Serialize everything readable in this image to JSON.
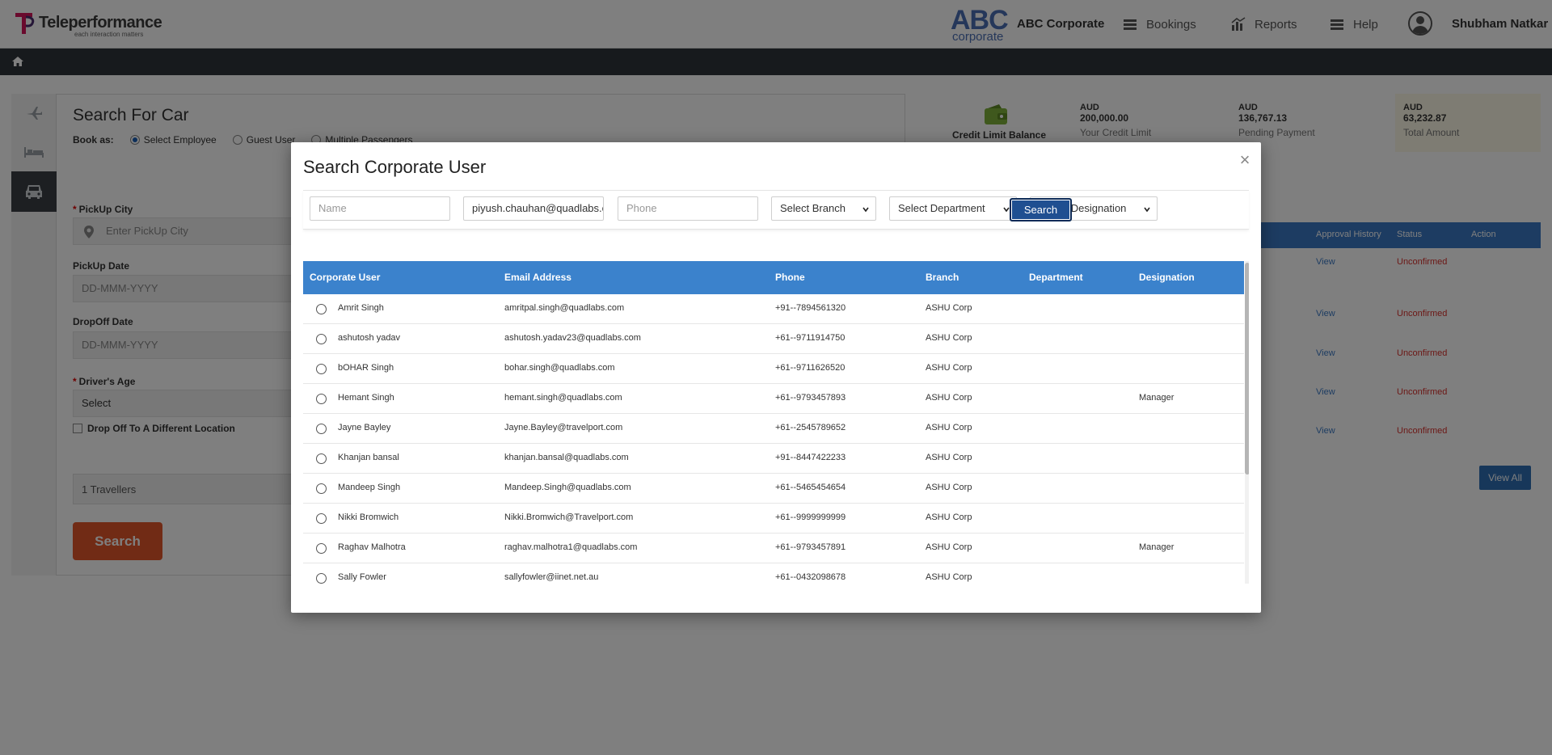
{
  "header": {
    "brand_name": "Teleperformance",
    "brand_tagline": "each interaction matters",
    "client_logo_big": "ABC",
    "client_logo_small": "corporate",
    "corporate_name": "ABC Corporate",
    "nav": [
      {
        "label": "Bookings",
        "icon": "list-icon"
      },
      {
        "label": "Reports",
        "icon": "bar-chart-icon"
      },
      {
        "label": "Help",
        "icon": "list-icon"
      }
    ],
    "user_name": "Shubham Natkar"
  },
  "background": {
    "form_title": "Search For Car",
    "book_as_label": "Book as:",
    "book_as_options": [
      "Select Employee",
      "Guest User",
      "Multiple Passengers"
    ],
    "pickup_city_label": "PickUp City",
    "pickup_city_placeholder": "Enter PickUp City",
    "pickup_date_label": "PickUp Date",
    "pickup_date_placeholder": "DD-MMM-YYYY",
    "dropoff_date_label": "DropOff Date",
    "dropoff_date_placeholder": "DD-MMM-YYYY",
    "drivers_age_label": "Driver's Age",
    "drivers_age_value": "Select",
    "different_location_label": "Drop Off To A Different Location",
    "travellers": "1 Travellers",
    "search_label": "Search",
    "credit_limit_label": "Credit Limit Balance",
    "credits": [
      {
        "currency": "AUD",
        "amount": "200,000.00",
        "desc": "Your Credit Limit"
      },
      {
        "currency": "AUD",
        "amount": "136,767.13",
        "desc": "Pending Payment"
      },
      {
        "currency": "AUD",
        "amount": "63,232.87",
        "desc": "Total Amount"
      }
    ],
    "table_headers": [
      "Approval History",
      "Status",
      "Action"
    ],
    "rows": [
      {
        "link": "View",
        "status": "Unconfirmed"
      },
      {
        "link": "View",
        "status": "Unconfirmed"
      },
      {
        "link": "View",
        "status": "Unconfirmed"
      },
      {
        "link": "View",
        "status": "Unconfirmed"
      },
      {
        "link": "View",
        "status": "Unconfirmed"
      }
    ],
    "view_all_label": "View All"
  },
  "modal": {
    "title": "Search Corporate User",
    "close_symbol": "×",
    "filters": {
      "name_placeholder": "Name",
      "email_value": "piyush.chauhan@quadlabs.c",
      "phone_placeholder": "Phone",
      "branch": "Select Branch",
      "department": "Select Department",
      "designation": "Select Designation",
      "search_label": "Search"
    },
    "columns": [
      "Corporate User",
      "Email Address",
      "Phone",
      "Branch",
      "Department",
      "Designation"
    ],
    "users": [
      {
        "name": "Amrit Singh",
        "email": "amritpal.singh@quadlabs.com",
        "phone": "+91--7894561320",
        "branch": "ASHU Corp",
        "department": "",
        "designation": ""
      },
      {
        "name": "ashutosh yadav",
        "email": "ashutosh.yadav23@quadlabs.com",
        "phone": "+61--9711914750",
        "branch": "ASHU Corp",
        "department": "",
        "designation": ""
      },
      {
        "name": "bOHAR Singh",
        "email": "bohar.singh@quadlabs.com",
        "phone": "+61--9711626520",
        "branch": "ASHU Corp",
        "department": "",
        "designation": ""
      },
      {
        "name": "Hemant Singh",
        "email": "hemant.singh@quadlabs.com",
        "phone": "+61--9793457893",
        "branch": "ASHU Corp",
        "department": "",
        "designation": "Manager"
      },
      {
        "name": "Jayne Bayley",
        "email": "Jayne.Bayley@travelport.com",
        "phone": "+61--2545789652",
        "branch": "ASHU Corp",
        "department": "",
        "designation": ""
      },
      {
        "name": "Khanjan bansal",
        "email": "khanjan.bansal@quadlabs.com",
        "phone": "+91--8447422233",
        "branch": "ASHU Corp",
        "department": "",
        "designation": ""
      },
      {
        "name": "Mandeep Singh",
        "email": "Mandeep.Singh@quadlabs.com",
        "phone": "+61--5465454654",
        "branch": "ASHU Corp",
        "department": "",
        "designation": ""
      },
      {
        "name": "Nikki Bromwich",
        "email": "Nikki.Bromwich@Travelport.com",
        "phone": "+61--9999999999",
        "branch": "ASHU Corp",
        "department": "",
        "designation": ""
      },
      {
        "name": "Raghav Malhotra",
        "email": "raghav.malhotra1@quadlabs.com",
        "phone": "+61--9793457891",
        "branch": "ASHU Corp",
        "department": "",
        "designation": "Manager"
      },
      {
        "name": "Sally Fowler",
        "email": "sallyfowler@iinet.net.au",
        "phone": "+61--0432098678",
        "branch": "ASHU Corp",
        "department": "",
        "designation": ""
      }
    ]
  }
}
